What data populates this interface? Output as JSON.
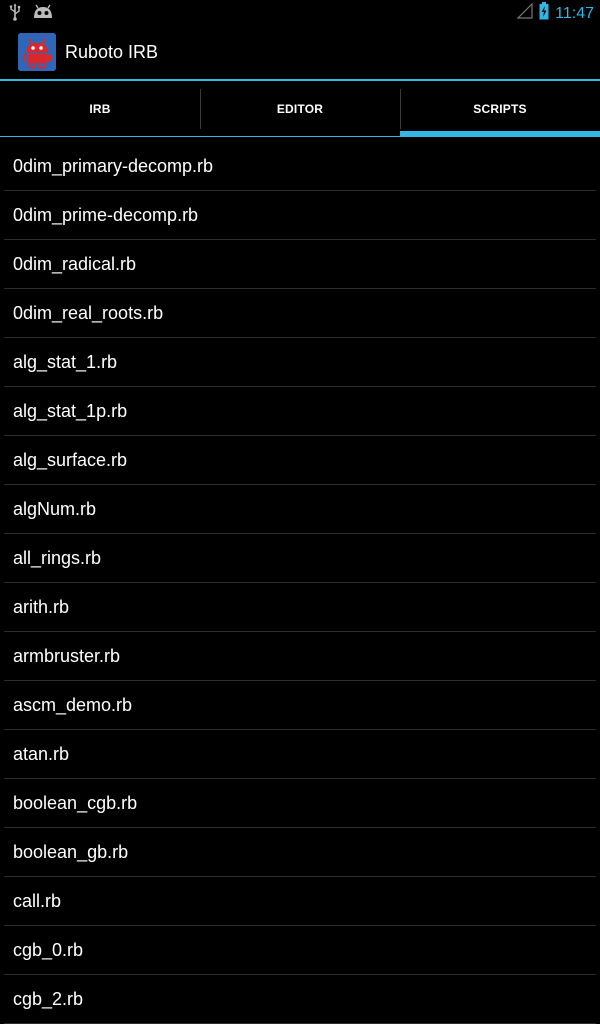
{
  "status_bar": {
    "clock": "11:47",
    "icons": [
      "usb-icon",
      "android-debug-icon",
      "signal-icon",
      "battery-charging-icon"
    ]
  },
  "action_bar": {
    "title": "Ruboto IRB",
    "app_icon": "ruboto-app-icon"
  },
  "tabs": [
    {
      "label": "IRB",
      "selected": false
    },
    {
      "label": "EDITOR",
      "selected": false
    },
    {
      "label": "SCRIPTS",
      "selected": true
    }
  ],
  "scripts": [
    "0dim_primary-decomp.rb",
    "0dim_prime-decomp.rb",
    "0dim_radical.rb",
    "0dim_real_roots.rb",
    "alg_stat_1.rb",
    "alg_stat_1p.rb",
    "alg_surface.rb",
    "algNum.rb",
    "all_rings.rb",
    "arith.rb",
    "armbruster.rb",
    "ascm_demo.rb",
    "atan.rb",
    "boolean_cgb.rb",
    "boolean_gb.rb",
    "call.rb",
    "cgb_0.rb",
    "cgb_2.rb"
  ],
  "colors": {
    "accent": "#33b5e5",
    "background": "#000000",
    "divider": "#2e2e2e"
  }
}
